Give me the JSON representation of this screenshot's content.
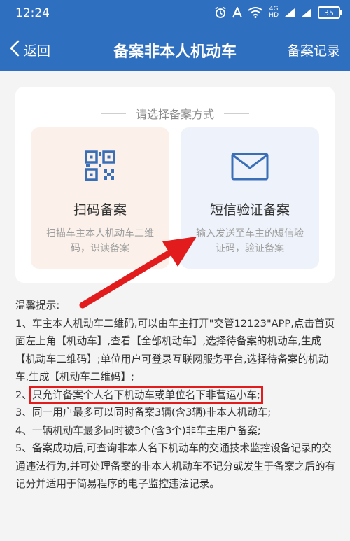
{
  "status": {
    "time": "12:24",
    "network_label": "4G",
    "hd_label": "HD",
    "battery": "35"
  },
  "nav": {
    "back_label": "返回",
    "title": "备案非本人机动车",
    "right_label": "备案记录"
  },
  "card": {
    "title": "请选择备案方式",
    "options": [
      {
        "title": "扫码备案",
        "desc": "扫描车主本人机动车二维码，识读备案",
        "icon": "qr-code-icon"
      },
      {
        "title": "短信验证备案",
        "desc": "输入发送至车主的短信验证码，验证备案",
        "icon": "envelope-icon"
      }
    ]
  },
  "tips": {
    "heading": "温馨提示:",
    "item1": "1、车主本人机动车二维码,可以由车主打开\"交管12123\"APP,点击首页面左上角【机动车】,查看【全部机动车】,选择待备案的机动车,生成【机动车二维码】;单位用户可登录互联网服务平台,选择待备案的机动车,生成【机动车二维码】;",
    "item2_prefix": "2、",
    "item2_highlight": "只允许备案个人名下机动车或单位名下非营运小车;",
    "item3": "3、同一用户最多可以同时备案3辆(含3辆)非本人机动车;",
    "item4": "4、一辆机动车最多同时被3个(含3个)非车主用户备案;",
    "item5": "5、备案成功后,可查询非本人名下机动车的交通技术监控设备记录的交通违法行为,并可处理备案的非本人机动车不记分或发生于备案之后的有记分并适用于简易程序的电子监控违法记录。"
  },
  "colors": {
    "header_blue": "#2f6fbf",
    "highlight_red": "#e21c1c",
    "scan_bg": "#fbf1ea",
    "sms_bg": "#eef3fb"
  }
}
